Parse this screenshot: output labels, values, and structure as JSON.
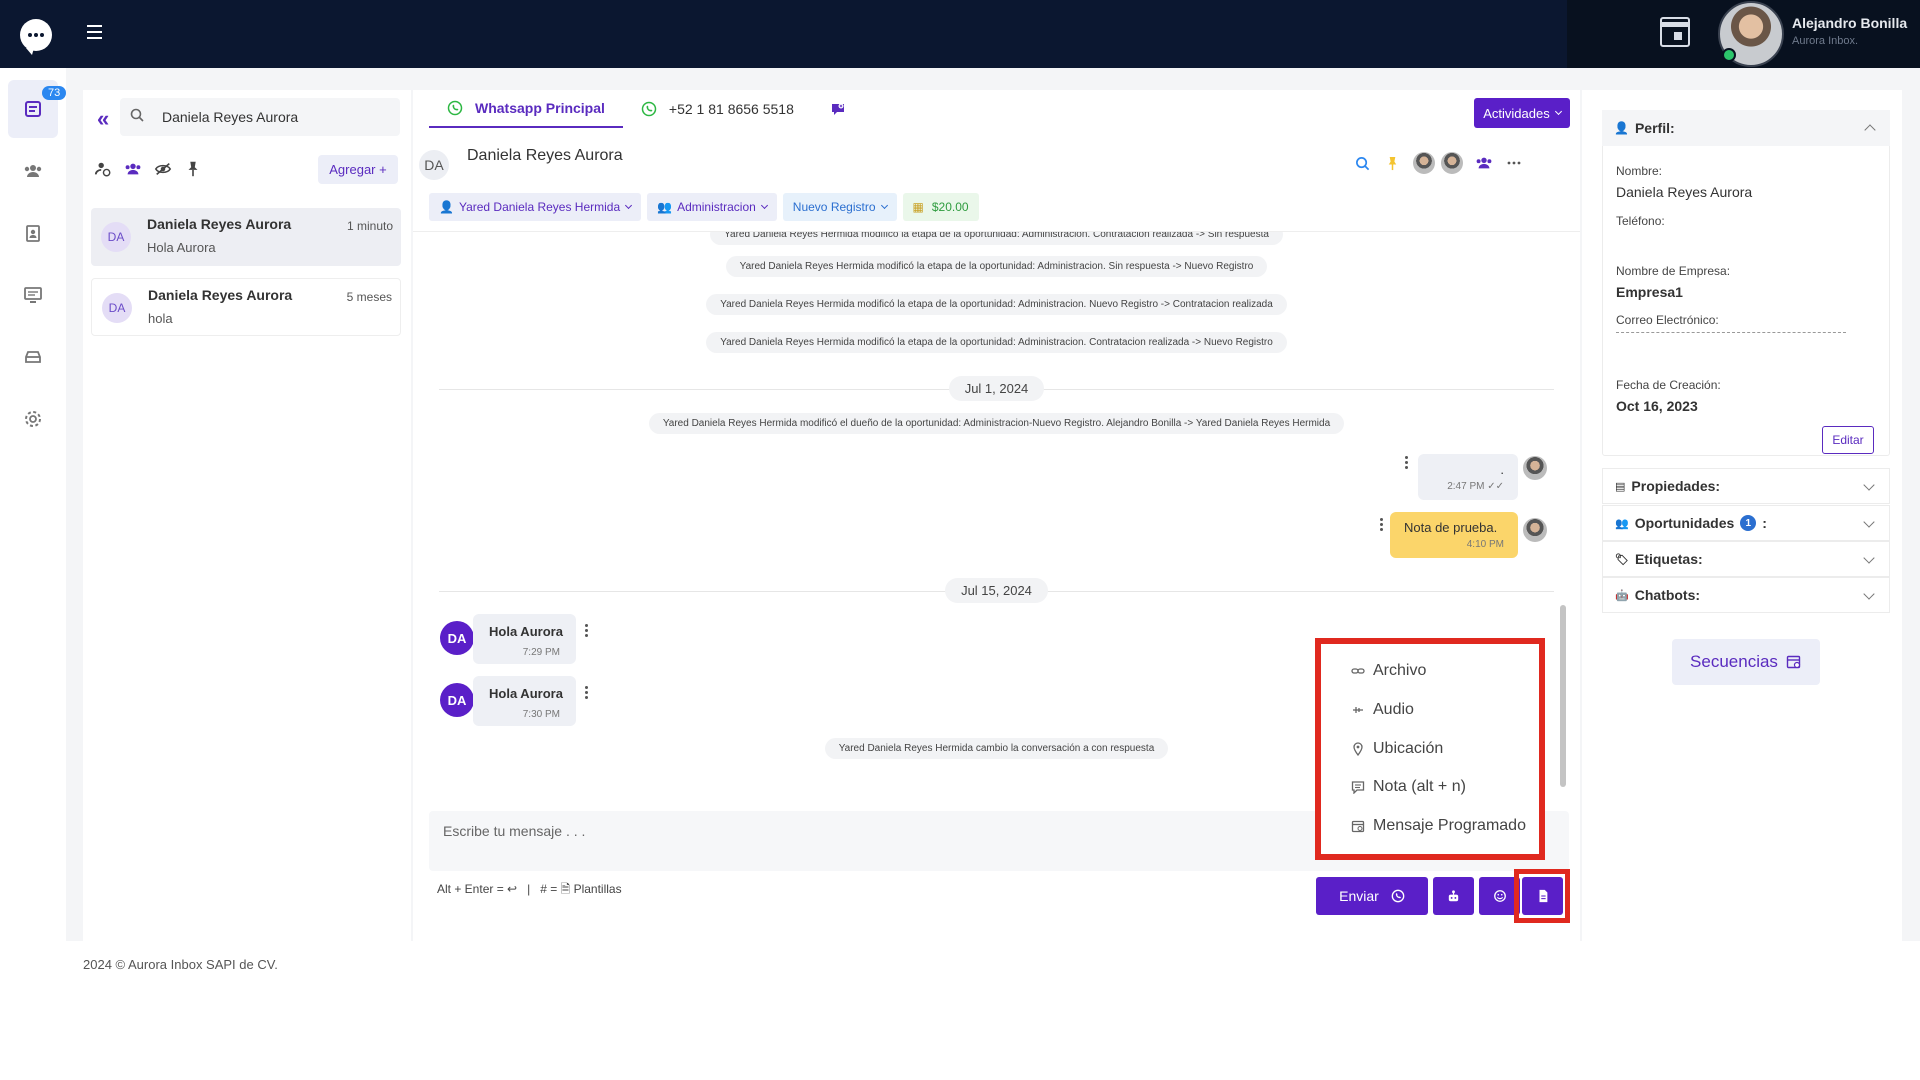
{
  "topbar": {
    "user_name": "Alejandro Bonilla",
    "user_subtitle": "Aurora Inbox."
  },
  "rail": {
    "chats_badge": "73",
    "icons": [
      "chats-icon",
      "contacts-icon",
      "address-book-icon",
      "monitor-icon",
      "inbox-icon",
      "settings-icon"
    ]
  },
  "sidebar": {
    "search_value": "Daniela Reyes Aurora",
    "add_label": "Agregar +",
    "conversations": [
      {
        "initials": "DA",
        "name": "Daniela Reyes Aurora",
        "preview": "Hola Aurora",
        "time": "1 minuto"
      },
      {
        "initials": "DA",
        "name": "Daniela Reyes Aurora",
        "preview": "hola",
        "time": "5 meses"
      }
    ]
  },
  "chat": {
    "tabs": [
      {
        "label": "Whatsapp Principal"
      },
      {
        "label": "+52 1 81 8656 5518"
      }
    ],
    "activities_label": "Actividades",
    "contact_initials": "DA",
    "contact_name": "Daniela Reyes Aurora",
    "tags": {
      "owner": "Yared Daniela Reyes Hermida",
      "team": "Administracion",
      "stage": "Nuevo Registro",
      "amount": "$20.00"
    },
    "system_messages": [
      "Yared Daniela Reyes Hermida modificó la etapa de la oportunidad: Administracion. Contratacion realizada -> Sin respuesta",
      "Yared Daniela Reyes Hermida modificó la etapa de la oportunidad: Administracion. Sin respuesta -> Nuevo Registro",
      "Yared Daniela Reyes Hermida modificó la etapa de la oportunidad: Administracion. Nuevo Registro -> Contratacion realizada",
      "Yared Daniela Reyes Hermida modificó la etapa de la oportunidad: Administracion. Contratacion realizada -> Nuevo Registro"
    ],
    "date1": "Jul 1, 2024",
    "owner_change_msg": "Yared Daniela Reyes Hermida modificó el dueño de la oportunidad: Administracion-Nuevo Registro. Alejandro Bonilla -> Yared Daniela Reyes Hermida",
    "out_msg1": {
      "text": ".",
      "time": "2:47 PM"
    },
    "out_msg2": {
      "text": "Nota de prueba.",
      "time": "4:10 PM"
    },
    "date2": "Jul 15, 2024",
    "in_msgs": [
      {
        "initials": "DA",
        "text": "Hola Aurora",
        "time": "7:29 PM"
      },
      {
        "initials": "DA",
        "text": "Hola Aurora",
        "time": "7:30 PM"
      }
    ],
    "status_msg": "Yared Daniela Reyes Hermida cambio la conversación a con respuesta",
    "composer_placeholder": "Escribe tu mensaje . . .",
    "hint_shortcut": "Alt + Enter = ↩",
    "hint_sep": "|",
    "hint_templates": "# = 🗎 Plantillas",
    "send_label": "Enviar",
    "attach_menu": [
      "Archivo",
      "Audio",
      "Ubicación",
      "Nota (alt + n)",
      "Mensaje Programado"
    ],
    "highlight_color": "#e0291f",
    "accent_color": "#5a1fc8"
  },
  "profile": {
    "perfil_title": "Perfil:",
    "nombre_label": "Nombre:",
    "nombre_value": "Daniela Reyes Aurora",
    "telefono_label": "Teléfono:",
    "empresa_label": "Nombre de Empresa:",
    "empresa_value": "Empresa1",
    "correo_label": "Correo Electrónico:",
    "fecha_label": "Fecha de Creación:",
    "fecha_value": "Oct 16, 2023",
    "edit_label": "Editar",
    "propiedades": "Propiedades:",
    "oportunidades": "Oportunidades",
    "oportunidades_count": "1",
    "oportunidades_colon": ":",
    "etiquetas": "Etiquetas:",
    "chatbots": "Chatbots:",
    "secuencias": "Secuencias"
  },
  "footer": {
    "text": "2024 © Aurora Inbox SAPI de CV."
  }
}
